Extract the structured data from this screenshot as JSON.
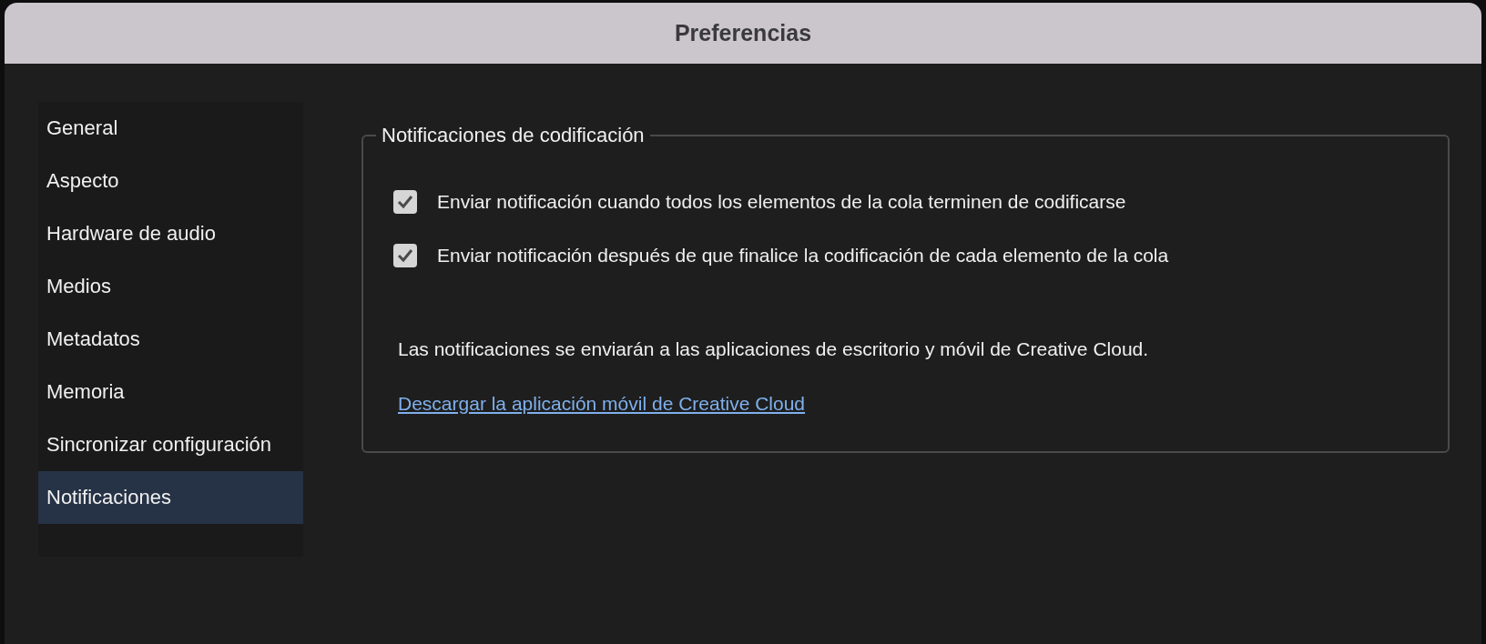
{
  "window": {
    "title": "Preferencias"
  },
  "sidebar": {
    "items": [
      {
        "label": "General",
        "selected": false
      },
      {
        "label": "Aspecto",
        "selected": false
      },
      {
        "label": "Hardware de audio",
        "selected": false
      },
      {
        "label": "Medios",
        "selected": false
      },
      {
        "label": "Metadatos",
        "selected": false
      },
      {
        "label": "Memoria",
        "selected": false
      },
      {
        "label": "Sincronizar configuración",
        "selected": false
      },
      {
        "label": "Notificaciones",
        "selected": true
      }
    ]
  },
  "group": {
    "title": "Notificaciones de codificación",
    "options": [
      {
        "label": "Enviar notificación cuando todos los elementos de la cola terminen de codificarse",
        "checked": true
      },
      {
        "label": "Enviar notificación después de que finalice la codificación de cada elemento de la cola",
        "checked": true
      }
    ],
    "note": "Las notificaciones se enviarán a las aplicaciones de escritorio y móvil de Creative Cloud.",
    "link": "Descargar la aplicación móvil de Creative Cloud"
  }
}
